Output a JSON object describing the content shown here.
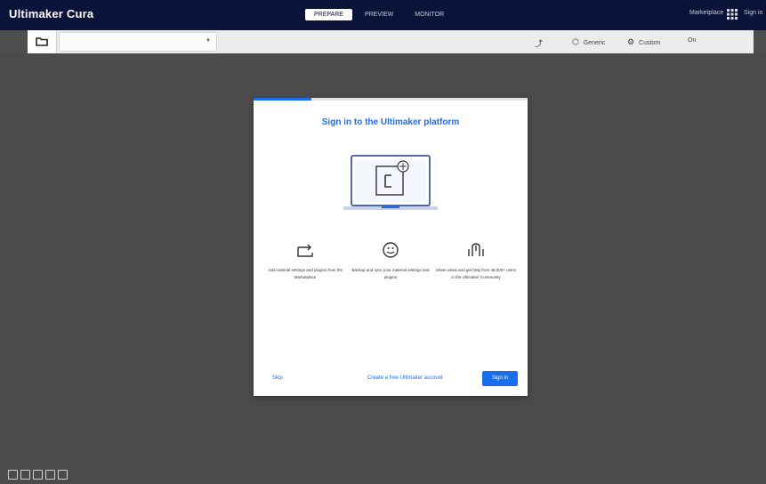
{
  "app": {
    "title": "Ultimaker Cura",
    "stages": [
      {
        "label": "PREPARE",
        "active": true
      },
      {
        "label": "PREVIEW",
        "active": false
      },
      {
        "label": "MONITOR",
        "active": false
      }
    ],
    "marketplace_label": "Marketplace",
    "account_label": "Sign in"
  },
  "toolbar": {
    "printer_placeholder": "",
    "items": [
      {
        "icon": "printer-icon",
        "label": "",
        "glyph": "⤴"
      },
      {
        "icon": "material-icon",
        "label": "Generic",
        "glyph": "⬡"
      },
      {
        "icon": "settings-icon",
        "label": "Custom",
        "glyph": "⚙"
      },
      {
        "icon": "extruder-icon",
        "label": "On",
        "glyph": ""
      }
    ]
  },
  "dialog": {
    "progress_fraction": 0.21,
    "title": "Sign in to the Ultimaker platform",
    "features": [
      {
        "icon": "sync-icon",
        "text": "Add material settings and plugins from the Marketplace"
      },
      {
        "icon": "cloud-icon",
        "text": "Backup and sync your material settings and plugins"
      },
      {
        "icon": "community-icon",
        "text": "Share ideas and get help from 48,000+ users in the Ultimaker Community"
      }
    ],
    "skip_label": "Skip",
    "create_account_label": "Create a free Ultimaker account",
    "next_label": "Sign in"
  },
  "colors": {
    "titlebar_bg": "#0c1339",
    "accent": "#196ef0",
    "viewport_bg": "#4b4b4b"
  }
}
